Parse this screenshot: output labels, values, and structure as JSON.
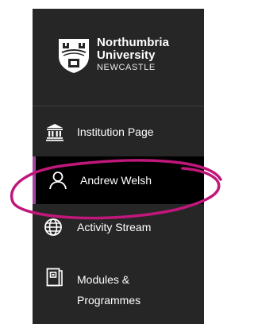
{
  "brand": {
    "line1": "Northumbria",
    "line2": "University",
    "line3": "NEWCASTLE",
    "crest_icon": "crest-icon"
  },
  "nav": {
    "items": [
      {
        "label": "Institution Page",
        "icon": "institution-icon"
      },
      {
        "label": "Andrew Welsh",
        "icon": "user-icon",
        "active": true
      },
      {
        "label": "Activity Stream",
        "icon": "globe-icon"
      },
      {
        "label": "Modules & Programmes",
        "icon": "modules-icon"
      }
    ]
  },
  "colors": {
    "sidebar_bg": "#262626",
    "active_bg": "#000000",
    "active_accent": "#a0479d",
    "annotation": "#c0177a"
  }
}
